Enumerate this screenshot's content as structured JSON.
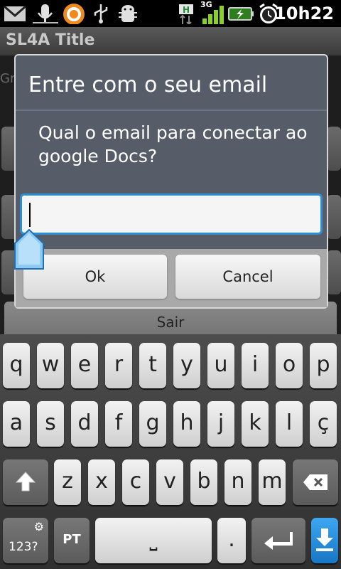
{
  "status_bar": {
    "time": "10h22",
    "network": "3G",
    "hspa": "H",
    "icons": [
      "gmail-icon",
      "voicemail-icon",
      "orange-app-icon",
      "usb-icon",
      "android-debug-icon",
      "hspa-icon",
      "signal-icon",
      "battery-charging-icon",
      "alarm-clock-icon"
    ]
  },
  "app": {
    "title": "SL4A Title",
    "partial_text": "Gr",
    "exit_button_label": "Sair"
  },
  "dialog": {
    "title": "Entre com o seu email",
    "message": "Qual o email para conectar ao google Docs?",
    "input_value": "",
    "ok_label": "Ok",
    "cancel_label": "Cancel"
  },
  "keyboard": {
    "row1": [
      "q",
      "w",
      "e",
      "r",
      "t",
      "y",
      "u",
      "i",
      "o",
      "p"
    ],
    "row2": [
      "a",
      "s",
      "d",
      "f",
      "g",
      "h",
      "j",
      "k",
      "l",
      "ç"
    ],
    "row3": [
      "z",
      "x",
      "c",
      "v",
      "b",
      "n",
      "m"
    ],
    "symbols_label": "123?",
    "language_label": "PT",
    "period_label": ".",
    "space_symbol": "⎵",
    "accent_color": "#2d8fd6"
  }
}
